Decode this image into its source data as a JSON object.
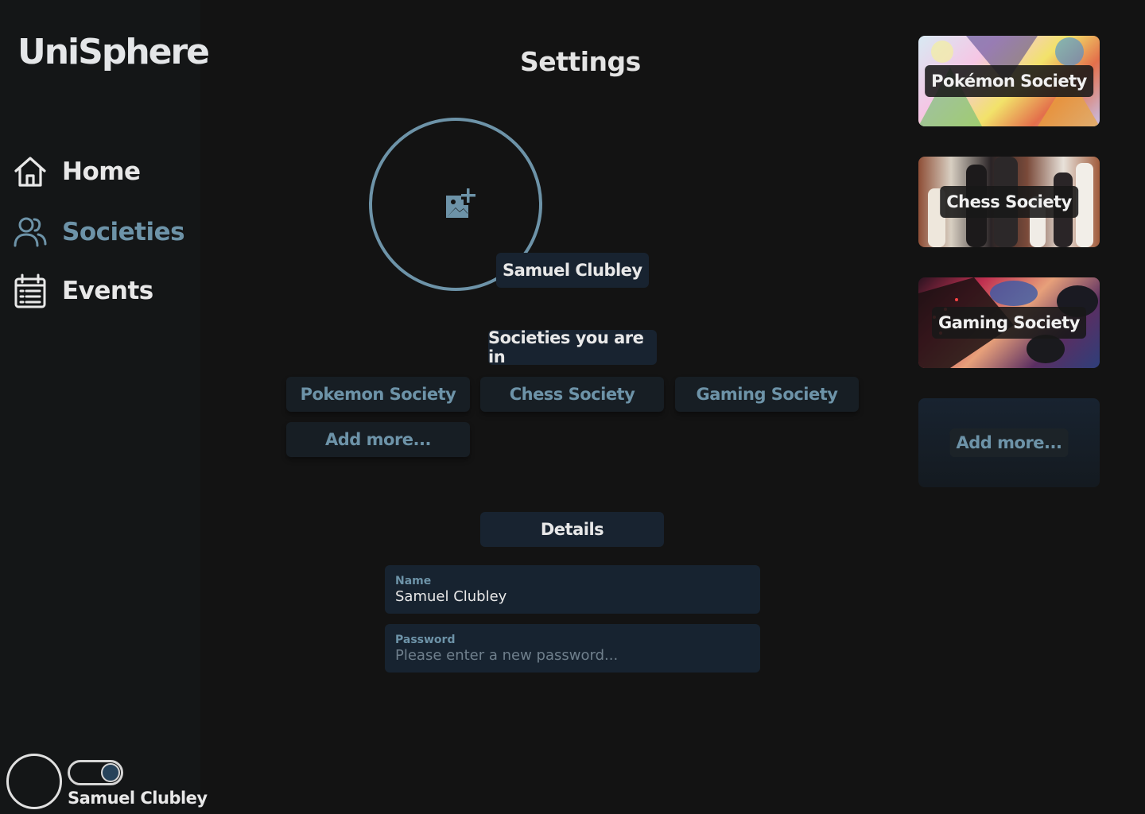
{
  "app": {
    "logo": "UniSphere"
  },
  "nav": {
    "items": [
      {
        "label": "Home",
        "icon": "home-icon",
        "active": false
      },
      {
        "label": "Societies",
        "icon": "users-icon",
        "active": true
      },
      {
        "label": "Events",
        "icon": "calendar-icon",
        "active": false
      }
    ]
  },
  "user": {
    "name": "Samuel Clubley"
  },
  "page": {
    "title": "Settings"
  },
  "profile": {
    "name": "Samuel Clubley",
    "photo_icon": "add-photo-icon"
  },
  "societies_section": {
    "title": "Societies you are in",
    "items": [
      "Pokemon Society",
      "Chess Society",
      "Gaming Society"
    ],
    "add_more": "Add more..."
  },
  "details_section": {
    "title": "Details",
    "name_label": "Name",
    "name_value": "Samuel Clubley",
    "password_label": "Password",
    "password_placeholder": "Please enter a new password..."
  },
  "cards": {
    "items": [
      "Pokémon Society",
      "Chess Society",
      "Gaming Society"
    ],
    "add_more": "Add more..."
  },
  "colors": {
    "background": "#131313",
    "sidebar": "#141617",
    "accent": "#6d93a8",
    "panel": "#182330",
    "text": "#e8e8e8"
  }
}
